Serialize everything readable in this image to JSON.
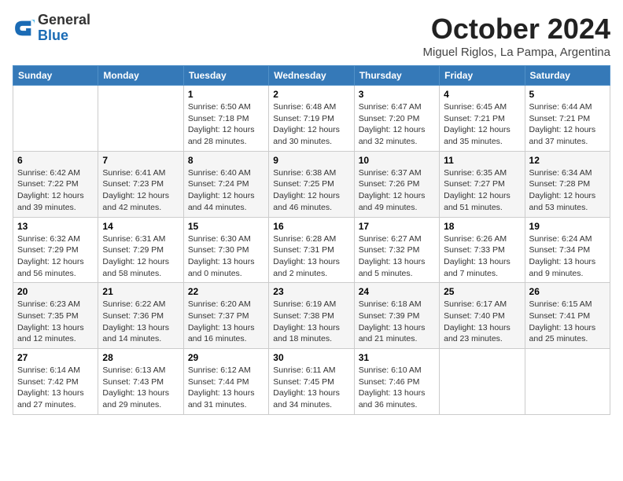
{
  "header": {
    "logo_general": "General",
    "logo_blue": "Blue",
    "title": "October 2024",
    "location": "Miguel Riglos, La Pampa, Argentina"
  },
  "weekdays": [
    "Sunday",
    "Monday",
    "Tuesday",
    "Wednesday",
    "Thursday",
    "Friday",
    "Saturday"
  ],
  "weeks": [
    [
      {
        "day": "",
        "info": ""
      },
      {
        "day": "",
        "info": ""
      },
      {
        "day": "1",
        "info": "Sunrise: 6:50 AM\nSunset: 7:18 PM\nDaylight: 12 hours\nand 28 minutes."
      },
      {
        "day": "2",
        "info": "Sunrise: 6:48 AM\nSunset: 7:19 PM\nDaylight: 12 hours\nand 30 minutes."
      },
      {
        "day": "3",
        "info": "Sunrise: 6:47 AM\nSunset: 7:20 PM\nDaylight: 12 hours\nand 32 minutes."
      },
      {
        "day": "4",
        "info": "Sunrise: 6:45 AM\nSunset: 7:21 PM\nDaylight: 12 hours\nand 35 minutes."
      },
      {
        "day": "5",
        "info": "Sunrise: 6:44 AM\nSunset: 7:21 PM\nDaylight: 12 hours\nand 37 minutes."
      }
    ],
    [
      {
        "day": "6",
        "info": "Sunrise: 6:42 AM\nSunset: 7:22 PM\nDaylight: 12 hours\nand 39 minutes."
      },
      {
        "day": "7",
        "info": "Sunrise: 6:41 AM\nSunset: 7:23 PM\nDaylight: 12 hours\nand 42 minutes."
      },
      {
        "day": "8",
        "info": "Sunrise: 6:40 AM\nSunset: 7:24 PM\nDaylight: 12 hours\nand 44 minutes."
      },
      {
        "day": "9",
        "info": "Sunrise: 6:38 AM\nSunset: 7:25 PM\nDaylight: 12 hours\nand 46 minutes."
      },
      {
        "day": "10",
        "info": "Sunrise: 6:37 AM\nSunset: 7:26 PM\nDaylight: 12 hours\nand 49 minutes."
      },
      {
        "day": "11",
        "info": "Sunrise: 6:35 AM\nSunset: 7:27 PM\nDaylight: 12 hours\nand 51 minutes."
      },
      {
        "day": "12",
        "info": "Sunrise: 6:34 AM\nSunset: 7:28 PM\nDaylight: 12 hours\nand 53 minutes."
      }
    ],
    [
      {
        "day": "13",
        "info": "Sunrise: 6:32 AM\nSunset: 7:29 PM\nDaylight: 12 hours\nand 56 minutes."
      },
      {
        "day": "14",
        "info": "Sunrise: 6:31 AM\nSunset: 7:29 PM\nDaylight: 12 hours\nand 58 minutes."
      },
      {
        "day": "15",
        "info": "Sunrise: 6:30 AM\nSunset: 7:30 PM\nDaylight: 13 hours\nand 0 minutes."
      },
      {
        "day": "16",
        "info": "Sunrise: 6:28 AM\nSunset: 7:31 PM\nDaylight: 13 hours\nand 2 minutes."
      },
      {
        "day": "17",
        "info": "Sunrise: 6:27 AM\nSunset: 7:32 PM\nDaylight: 13 hours\nand 5 minutes."
      },
      {
        "day": "18",
        "info": "Sunrise: 6:26 AM\nSunset: 7:33 PM\nDaylight: 13 hours\nand 7 minutes."
      },
      {
        "day": "19",
        "info": "Sunrise: 6:24 AM\nSunset: 7:34 PM\nDaylight: 13 hours\nand 9 minutes."
      }
    ],
    [
      {
        "day": "20",
        "info": "Sunrise: 6:23 AM\nSunset: 7:35 PM\nDaylight: 13 hours\nand 12 minutes."
      },
      {
        "day": "21",
        "info": "Sunrise: 6:22 AM\nSunset: 7:36 PM\nDaylight: 13 hours\nand 14 minutes."
      },
      {
        "day": "22",
        "info": "Sunrise: 6:20 AM\nSunset: 7:37 PM\nDaylight: 13 hours\nand 16 minutes."
      },
      {
        "day": "23",
        "info": "Sunrise: 6:19 AM\nSunset: 7:38 PM\nDaylight: 13 hours\nand 18 minutes."
      },
      {
        "day": "24",
        "info": "Sunrise: 6:18 AM\nSunset: 7:39 PM\nDaylight: 13 hours\nand 21 minutes."
      },
      {
        "day": "25",
        "info": "Sunrise: 6:17 AM\nSunset: 7:40 PM\nDaylight: 13 hours\nand 23 minutes."
      },
      {
        "day": "26",
        "info": "Sunrise: 6:15 AM\nSunset: 7:41 PM\nDaylight: 13 hours\nand 25 minutes."
      }
    ],
    [
      {
        "day": "27",
        "info": "Sunrise: 6:14 AM\nSunset: 7:42 PM\nDaylight: 13 hours\nand 27 minutes."
      },
      {
        "day": "28",
        "info": "Sunrise: 6:13 AM\nSunset: 7:43 PM\nDaylight: 13 hours\nand 29 minutes."
      },
      {
        "day": "29",
        "info": "Sunrise: 6:12 AM\nSunset: 7:44 PM\nDaylight: 13 hours\nand 31 minutes."
      },
      {
        "day": "30",
        "info": "Sunrise: 6:11 AM\nSunset: 7:45 PM\nDaylight: 13 hours\nand 34 minutes."
      },
      {
        "day": "31",
        "info": "Sunrise: 6:10 AM\nSunset: 7:46 PM\nDaylight: 13 hours\nand 36 minutes."
      },
      {
        "day": "",
        "info": ""
      },
      {
        "day": "",
        "info": ""
      }
    ]
  ]
}
